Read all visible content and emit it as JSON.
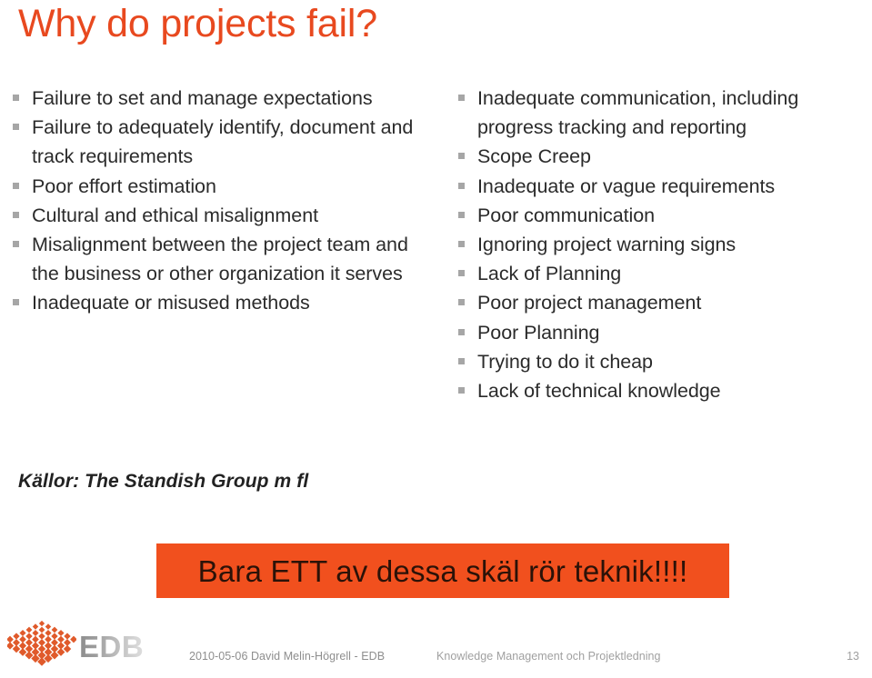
{
  "slide": {
    "title": "Why do projects fail?",
    "accent_color": "#E8491F",
    "banner_color": "#F1501E",
    "bullet_marker_color": "#a6a6a6",
    "body_text_color": "#2b2b2b"
  },
  "columns": {
    "left": {
      "bullets": [
        "Failure to set and manage expectations",
        "Failure to adequately identify, document and track requirements",
        "Poor effort estimation",
        "Cultural and ethical misalignment",
        "Misalignment between the project team and the business or other organization it serves",
        "Inadequate or misused methods"
      ]
    },
    "right": {
      "bullets": [
        "Inadequate communication, including progress tracking and reporting",
        "Scope Creep",
        "Inadequate or vague requirements",
        "Poor communication",
        "Ignoring project warning signs",
        "Lack of Planning",
        "Poor project management",
        "Poor Planning",
        "Trying to do it cheap",
        "Lack of technical knowledge"
      ]
    }
  },
  "source_note": "Källor: The Standish Group m fl",
  "callout": {
    "text": "Bara ETT av dessa skäl rör teknik!!!!"
  },
  "footer": {
    "logo_word": "EDB",
    "logo_mark_name": "edb-diamond-mark",
    "date_author": "2010-05-06 David Melin-Högrell - EDB",
    "course": "Knowledge Management och Projektledning",
    "page_number": "13"
  }
}
